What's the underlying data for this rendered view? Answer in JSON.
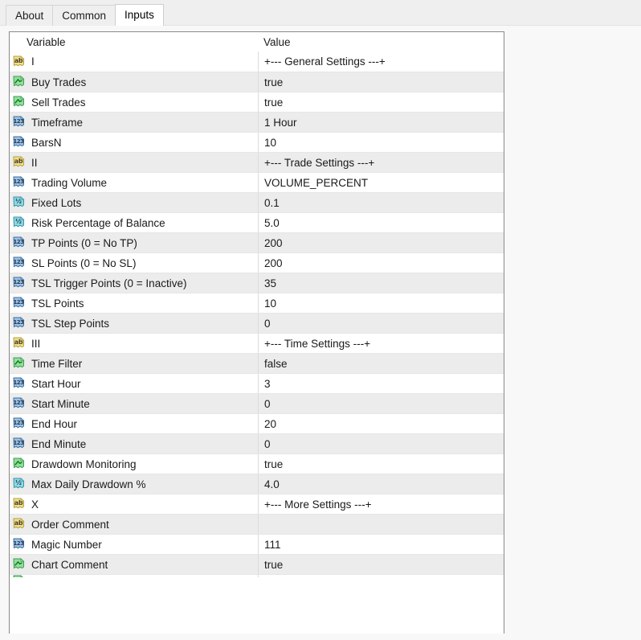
{
  "window": {
    "background": "#f8f8f8",
    "tabstrip_background": "#efefef"
  },
  "tabs": [
    {
      "label": "About",
      "active": false
    },
    {
      "label": "Common",
      "active": false
    },
    {
      "label": "Inputs",
      "active": true
    }
  ],
  "table": {
    "columns": {
      "variable": "Variable",
      "value": "Value"
    },
    "rows": [
      {
        "icon": "string-icon",
        "type": "ab",
        "variable": "I",
        "value": "+--- General Settings ---+"
      },
      {
        "icon": "bool-icon",
        "type": "bool",
        "variable": "Buy Trades",
        "value": "true"
      },
      {
        "icon": "bool-icon",
        "type": "bool",
        "variable": "Sell Trades",
        "value": "true"
      },
      {
        "icon": "int-icon",
        "type": "123",
        "variable": "Timeframe",
        "value": "1 Hour"
      },
      {
        "icon": "int-icon",
        "type": "123",
        "variable": "BarsN",
        "value": "10"
      },
      {
        "icon": "string-icon",
        "type": "ab",
        "variable": "II",
        "value": "+--- Trade Settings ---+"
      },
      {
        "icon": "int-icon",
        "type": "123",
        "variable": "Trading Volume",
        "value": "VOLUME_PERCENT"
      },
      {
        "icon": "double-icon",
        "type": "half",
        "variable": "Fixed Lots",
        "value": "0.1"
      },
      {
        "icon": "double-icon",
        "type": "half",
        "variable": "Risk Percentage of Balance",
        "value": "5.0"
      },
      {
        "icon": "int-icon",
        "type": "123",
        "variable": "TP Points (0 = No TP)",
        "value": "200"
      },
      {
        "icon": "int-icon",
        "type": "123",
        "variable": "SL Points (0 = No SL)",
        "value": "200"
      },
      {
        "icon": "int-icon",
        "type": "123",
        "variable": "TSL Trigger Points (0 = Inactive)",
        "value": "35"
      },
      {
        "icon": "int-icon",
        "type": "123",
        "variable": "TSL Points",
        "value": "10"
      },
      {
        "icon": "int-icon",
        "type": "123",
        "variable": "TSL Step Points",
        "value": "0"
      },
      {
        "icon": "string-icon",
        "type": "ab",
        "variable": "III",
        "value": "+--- Time Settings ---+"
      },
      {
        "icon": "bool-icon",
        "type": "bool",
        "variable": "Time Filter",
        "value": "false"
      },
      {
        "icon": "int-icon",
        "type": "123",
        "variable": "Start Hour",
        "value": "3"
      },
      {
        "icon": "int-icon",
        "type": "123",
        "variable": "Start Minute",
        "value": "0"
      },
      {
        "icon": "int-icon",
        "type": "123",
        "variable": "End Hour",
        "value": "20"
      },
      {
        "icon": "int-icon",
        "type": "123",
        "variable": "End Minute",
        "value": "0"
      },
      {
        "icon": "bool-icon",
        "type": "bool",
        "variable": "Drawdown Monitoring",
        "value": "true"
      },
      {
        "icon": "double-icon",
        "type": "half",
        "variable": "Max Daily Drawdown %",
        "value": "4.0"
      },
      {
        "icon": "string-icon",
        "type": "ab",
        "variable": "X",
        "value": "+--- More Settings ---+"
      },
      {
        "icon": "string-icon",
        "type": "ab",
        "variable": "Order Comment",
        "value": ""
      },
      {
        "icon": "int-icon",
        "type": "123",
        "variable": "Magic Number",
        "value": "111"
      },
      {
        "icon": "bool-icon",
        "type": "bool",
        "variable": "Chart Comment",
        "value": "true"
      }
    ],
    "partial_row": {
      "icon": "bool-icon",
      "type": "bool",
      "variable": "",
      "value": ""
    }
  },
  "colors": {
    "icon_string_fill": "#f2e08a",
    "icon_string_stroke": "#b5a03c",
    "icon_bool_fill": "#8fe09a",
    "icon_bool_stroke": "#3f9b53",
    "icon_int_fill": "#9dc3e6",
    "icon_int_stroke": "#3f6f9f",
    "icon_double_fill": "#8fd8e6",
    "icon_double_stroke": "#3a93a5",
    "row_alt": "#ececec",
    "row_base": "#ffffff",
    "grid_line": "#e6e6e6",
    "panel_border": "#8a8a8a"
  }
}
